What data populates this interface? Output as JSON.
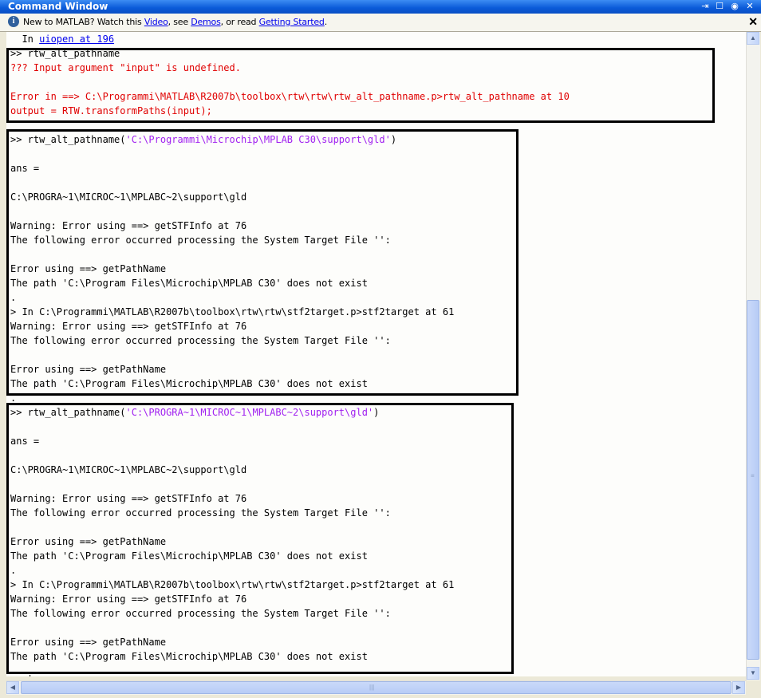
{
  "window": {
    "title": "Command Window",
    "controls": {
      "undock": "⇥",
      "maximize": "☐",
      "minimize": "◉",
      "close": "✕"
    }
  },
  "infobar": {
    "prefix": "New to MATLAB? Watch this ",
    "video_link": "Video",
    "sep1": ", see ",
    "demos_link": "Demos",
    "sep2": ", or read ",
    "getting_started_link": "Getting Started",
    "suffix": ".",
    "close": "✕"
  },
  "console": {
    "top_line_prefix": "  In ",
    "top_line_link": "uiopen at 196",
    "block1": {
      "cmd": ">> rtw_alt_pathname",
      "err1": "??? Input argument \"input\" is undefined.",
      "err2": "Error in ==> C:\\Programmi\\MATLAB\\R2007b\\toolbox\\rtw\\rtw\\rtw_alt_pathname.p>rtw_alt_pathname at 10",
      "err3": "output = RTW.transformPaths(input);"
    },
    "block2": {
      "cmd_prefix": ">> rtw_alt_pathname(",
      "cmd_arg": "'C:\\Programmi\\Microchip\\MPLAB C30\\support\\gld'",
      "cmd_suffix": ")",
      "lines": [
        "ans =",
        "C:\\PROGRA~1\\MICROC~1\\MPLABC~2\\support\\gld",
        "Warning: Error using ==> getSTFInfo at 76",
        "The following error occurred processing the System Target File '':",
        "Error using ==> getPathName",
        "The path 'C:\\Program Files\\Microchip\\MPLAB C30' does not exist",
        ".",
        "> In C:\\Programmi\\MATLAB\\R2007b\\toolbox\\rtw\\rtw\\stf2target.p>stf2target at 61",
        "Warning: Error using ==> getSTFInfo at 76",
        "The following error occurred processing the System Target File '':",
        "Error using ==> getPathName",
        "The path 'C:\\Program Files\\Microchip\\MPLAB C30' does not exist",
        "."
      ]
    },
    "block3": {
      "cmd_prefix": ">> rtw_alt_pathname(",
      "cmd_arg": "'C:\\PROGRA~1\\MICROC~1\\MPLABC~2\\support\\gld'",
      "cmd_suffix": ")",
      "lines": [
        "ans =",
        "C:\\PROGRA~1\\MICROC~1\\MPLABC~2\\support\\gld",
        "Warning: Error using ==> getSTFInfo at 76",
        "The following error occurred processing the System Target File '':",
        "Error using ==> getPathName",
        "The path 'C:\\Program Files\\Microchip\\MPLAB C30' does not exist",
        ".",
        "> In C:\\Programmi\\MATLAB\\R2007b\\toolbox\\rtw\\rtw\\stf2target.p>stf2target at 61",
        "Warning: Error using ==> getSTFInfo at 76",
        "The following error occurred processing the System Target File '':",
        "Error using ==> getPathName",
        "The path 'C:\\Program Files\\Microchip\\MPLAB C30' does not exist"
      ]
    },
    "cursor": "'"
  },
  "scrollbars": {
    "up": "▲",
    "down": "▼",
    "left": "◀",
    "right": "▶",
    "grip": "≡",
    "hgrip": "|||"
  }
}
